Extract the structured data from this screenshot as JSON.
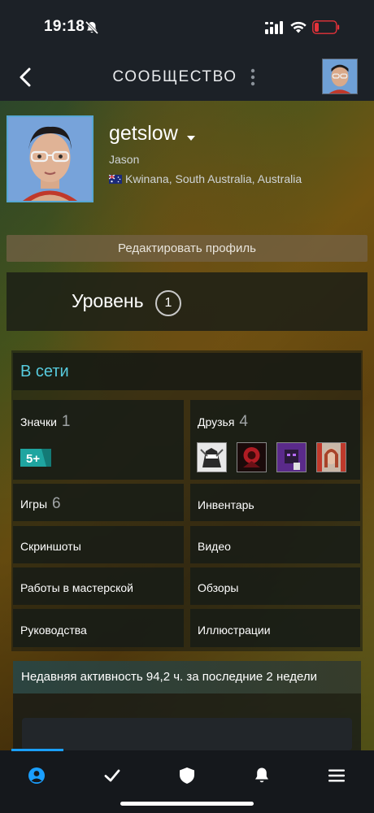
{
  "status_bar": {
    "time": "19:18"
  },
  "nav": {
    "title": "СООБЩЕСТВО"
  },
  "profile": {
    "username": "getslow",
    "real_name": "Jason",
    "location": "Kwinana, South Australia, Australia",
    "edit_button": "Редактировать профиль",
    "level_label": "Уровень",
    "level_value": "1",
    "status": "В сети"
  },
  "tiles": {
    "badges": {
      "label": "Значки",
      "count": "1",
      "badge_text": "5+"
    },
    "friends": {
      "label": "Друзья",
      "count": "4"
    },
    "games": {
      "label": "Игры",
      "count": "6"
    },
    "inventory": {
      "label": "Инвентарь"
    },
    "screenshots": {
      "label": "Скриншоты"
    },
    "videos": {
      "label": "Видео"
    },
    "workshop": {
      "label": "Работы в мастерской"
    },
    "reviews": {
      "label": "Обзоры"
    },
    "guides": {
      "label": "Руководства"
    },
    "artwork": {
      "label": "Иллюстрации"
    }
  },
  "activity": {
    "text": "Недавняя активность 94,2 ч. за последние 2 недели"
  },
  "tabbar": {
    "items": [
      "profile-icon",
      "checkmark-icon",
      "shield-icon",
      "bell-icon",
      "menu-icon"
    ],
    "active_color": "#1a9fff"
  },
  "colors": {
    "accent": "#1a9fff",
    "online": "#57cbde",
    "battery_low": "#e5323a"
  }
}
